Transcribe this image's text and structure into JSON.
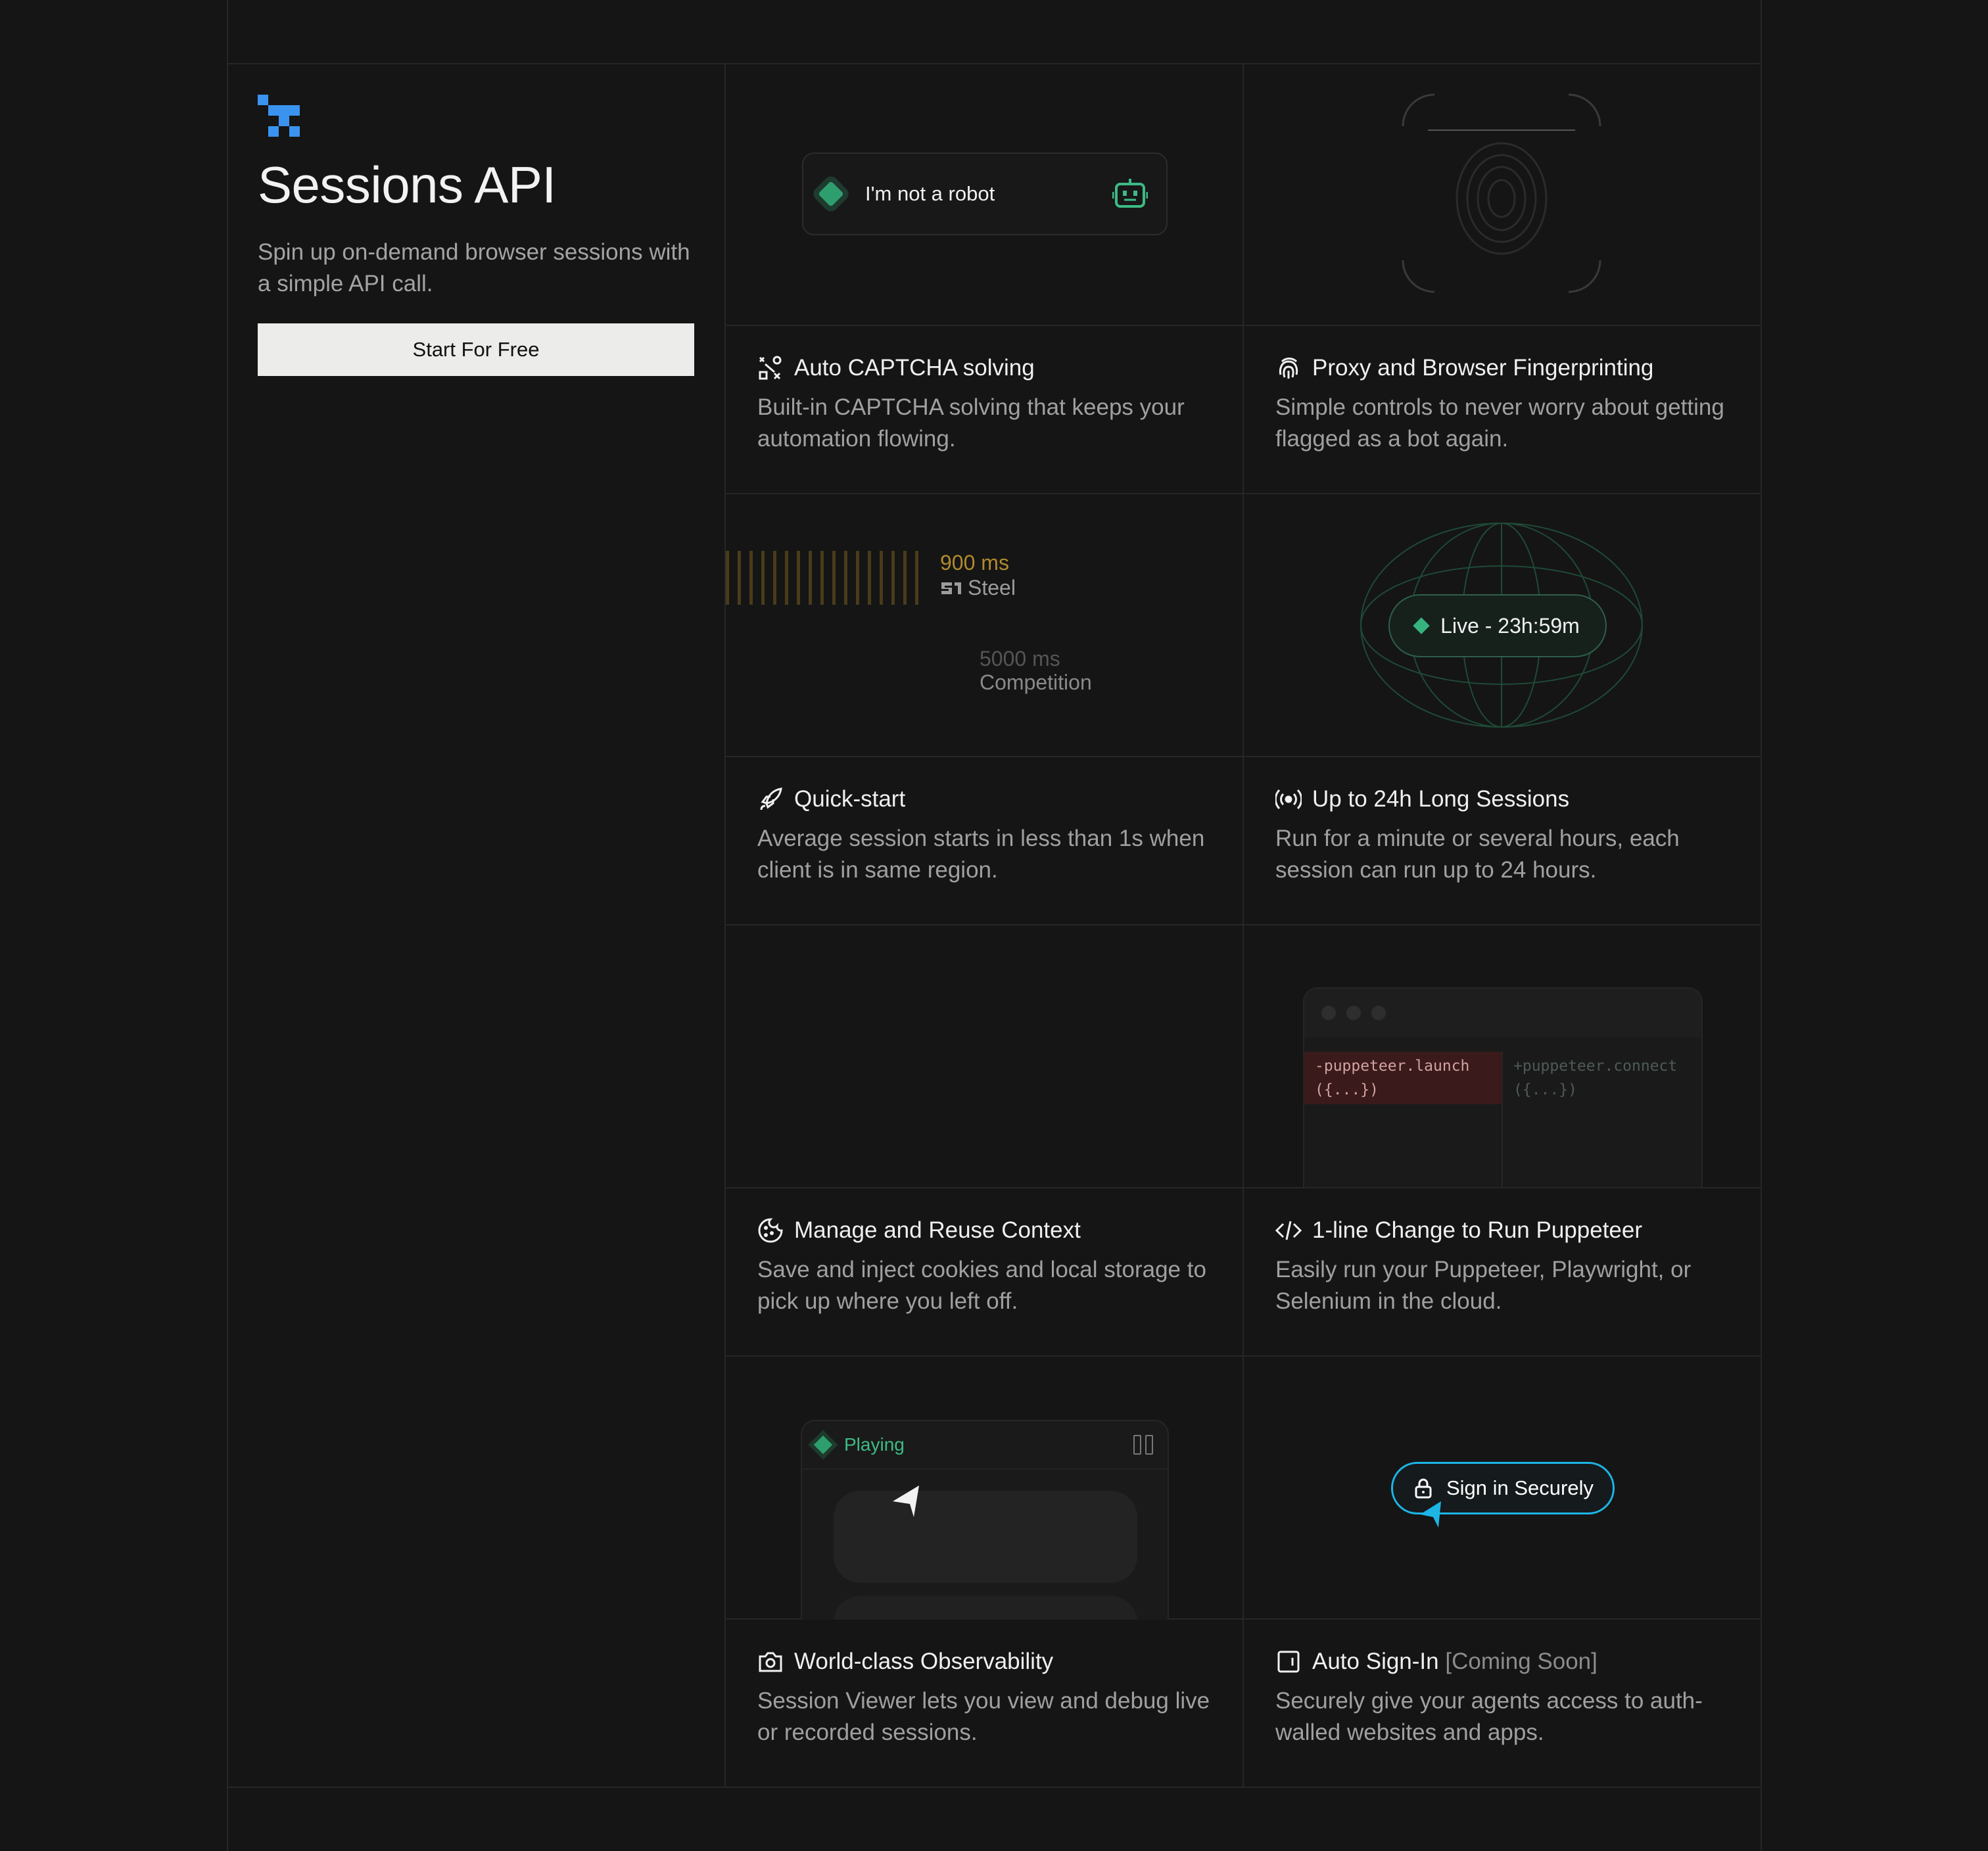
{
  "hero": {
    "title": "Sessions API",
    "subtitle": "Spin up on-demand browser sessions with a simple API call.",
    "cta_label": "Start For Free",
    "logo_icon": "steel-pixel-logo"
  },
  "captcha_widget": {
    "label": "I'm not a robot",
    "icon": "robot-face-icon"
  },
  "latency": {
    "steel_value": "900 ms",
    "steel_label": "Steel",
    "competition_value": "5000 ms",
    "competition_label": "Competition"
  },
  "live_badge": {
    "label": "Live - 23h:59m"
  },
  "code_diff": {
    "removed_line1": "-puppeteer.launch",
    "removed_line2": "({...})",
    "added_line1": "+puppeteer.connect",
    "added_line2": "({...})"
  },
  "player": {
    "status": "Playing"
  },
  "signin_button": {
    "label": "Sign in Securely"
  },
  "features": [
    {
      "icon": "captcha-puzzle-icon",
      "title": "Auto CAPTCHA solving",
      "description": "Built-in CAPTCHA solving that keeps your automation flowing."
    },
    {
      "icon": "fingerprint-icon",
      "title": "Proxy and Browser Fingerprinting",
      "description": "Simple controls to never worry about getting flagged as a bot again."
    },
    {
      "icon": "rocket-icon",
      "title": "Quick-start",
      "description": "Average session starts in less than 1s when client is in same region."
    },
    {
      "icon": "broadcast-icon",
      "title": "Up to 24h Long Sessions",
      "description": "Run for a minute or several hours, each session can run up to 24 hours."
    },
    {
      "icon": "cookie-icon",
      "title": "Manage and Reuse Context",
      "description": "Save and inject cookies and local storage to pick up where you left off."
    },
    {
      "icon": "code-icon",
      "title": "1-line Change to Run Puppeteer",
      "description": "Easily run your Puppeteer, Playwright, or Selenium in the cloud."
    },
    {
      "icon": "camera-icon",
      "title": "World-class Observability",
      "description": "Session Viewer lets you view and debug live or recorded sessions."
    },
    {
      "icon": "login-icon",
      "title": "Auto Sign-In",
      "title_suffix": "[Coming Soon]",
      "description": "Securely give your agents access to auth-walled websites and apps."
    }
  ],
  "colors": {
    "background": "#151515",
    "grid_line": "#262626",
    "accent_blue": "#3b93f0",
    "accent_green": "#36b37e",
    "accent_gold": "#b08a2c",
    "accent_cyan": "#1db5e6"
  }
}
